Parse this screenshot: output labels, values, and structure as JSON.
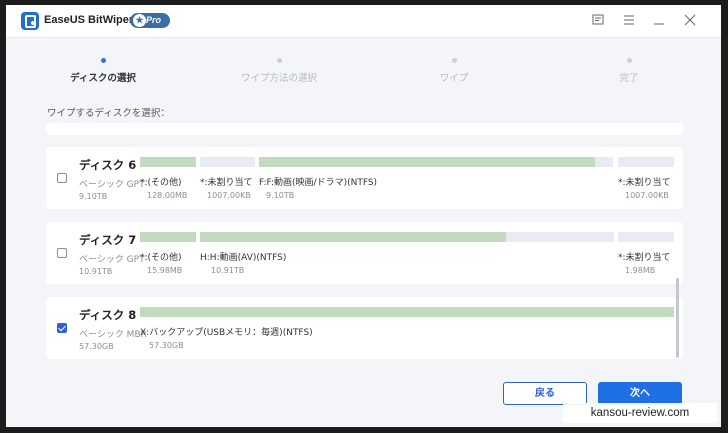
{
  "app": {
    "title": "EaseUS BitWiper",
    "badge": "Pro",
    "accent_color": "#2b78e4"
  },
  "titlebar_icons": [
    "feedback-icon",
    "menu-icon",
    "minimize-icon",
    "close-icon"
  ],
  "steps": [
    {
      "label": "ディスクの選択",
      "active": true
    },
    {
      "label": "ワイプ方法の選択",
      "active": false
    },
    {
      "label": "ワイプ",
      "active": false
    },
    {
      "label": "完了",
      "active": false
    }
  ],
  "section_label": "ワイプするディスクを選択：",
  "disks": [
    {
      "name": "ディスク 6",
      "type": "ベーシック GPT",
      "size": "9.10TB",
      "checked": false,
      "partitions": [
        {
          "name": "*:(その他)",
          "size": "128.00MB",
          "fill": 1.0
        },
        {
          "name": "*:未割り当て",
          "size": "1007.00KB",
          "fill": 0.0
        },
        {
          "name": "F:F:動画(映画/ドラマ)(NTFS)",
          "size": "9.10TB",
          "fill": 0.95
        },
        {
          "name": "*:未割り当て",
          "size": "1007.00KB",
          "fill": 0.0
        }
      ]
    },
    {
      "name": "ディスク 7",
      "type": "ベーシック GPT",
      "size": "10.91TB",
      "checked": false,
      "partitions": [
        {
          "name": "*:(その他)",
          "size": "15.98MB",
          "fill": 1.0
        },
        {
          "name": "H:H:動画(AV)(NTFS)",
          "size": "10.91TB",
          "fill": 0.74
        },
        {
          "name": "*:未割り当て",
          "size": "1.98MB",
          "fill": 0.0
        }
      ]
    },
    {
      "name": "ディスク 8",
      "type": "ベーシック MBR",
      "size": "57.30GB",
      "checked": true,
      "partitions": [
        {
          "name": "X:バックアップ(USBメモリ：毎週)(NTFS)",
          "size": "57.30GB",
          "fill": 1.0
        }
      ]
    }
  ],
  "buttons": {
    "back": "戻る",
    "next": "次へ"
  },
  "watermark": "kansou-review.com"
}
